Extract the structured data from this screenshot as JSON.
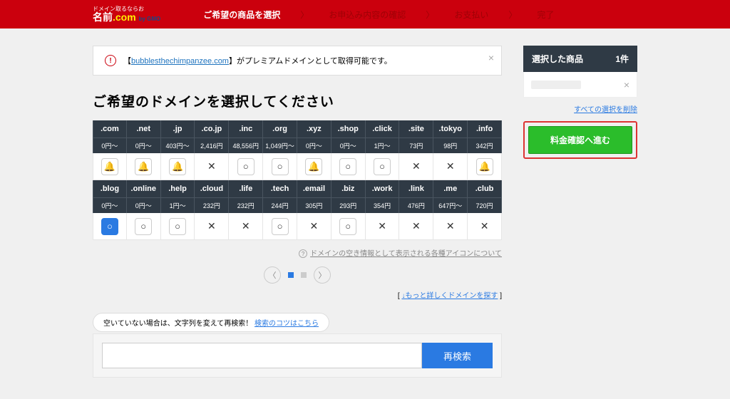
{
  "logo": {
    "tagline": "ドメイン取るならお",
    "label": "名前",
    "dot": ".",
    "com": "com",
    "gmo": "by GMO"
  },
  "steps": [
    "ご希望の商品を選択",
    "お申込み内容の確認",
    "お支払い",
    "完了"
  ],
  "notice": {
    "open": "【",
    "domain": "bubblesthechimpanzee.com",
    "close_b": "】",
    "text": "がプレミアムドメインとして取得可能です。",
    "x": "×"
  },
  "heading": "ご希望のドメインを選択してください",
  "rows": [
    {
      "tlds": [
        ".com",
        ".net",
        ".jp",
        ".co.jp",
        ".inc",
        ".org",
        ".xyz",
        ".shop",
        ".click",
        ".site",
        ".tokyo",
        ".info"
      ],
      "prices": [
        "0円～",
        "0円～",
        "403円～",
        "2,416円",
        "48,556円",
        "1,049円～",
        "0円～",
        "0円～",
        "1円～",
        "73円",
        "98円",
        "342円"
      ],
      "status": [
        "bell",
        "bell",
        "bell",
        "x",
        "o",
        "o",
        "bell",
        "o",
        "o",
        "x",
        "x",
        "bell"
      ]
    },
    {
      "tlds": [
        ".blog",
        ".online",
        ".help",
        ".cloud",
        ".life",
        ".tech",
        ".email",
        ".biz",
        ".work",
        ".link",
        ".me",
        ".club"
      ],
      "prices": [
        "0円～",
        "0円～",
        "1円～",
        "232円",
        "232円",
        "244円",
        "305円",
        "293円",
        "354円",
        "476円",
        "647円～",
        "720円"
      ],
      "status": [
        "o-blue",
        "o",
        "o",
        "x",
        "x",
        "o",
        "x",
        "o",
        "x",
        "x",
        "x",
        "x"
      ]
    }
  ],
  "info_link": "ドメインの空き情報として表示される各種アイコンについて",
  "more_link": "↓もっと詳しくドメインを探す",
  "search_tip_text": "空いていない場合は、文字列を変えて再検索！",
  "search_tip_link": "検索のコツはこちら",
  "search_placeholder": "",
  "search_btn": "再検索",
  "side": {
    "title": "選択した商品",
    "count": "1件",
    "clear": "すべての選択を削除",
    "proceed": "料金確認へ進む",
    "rm": "×"
  }
}
